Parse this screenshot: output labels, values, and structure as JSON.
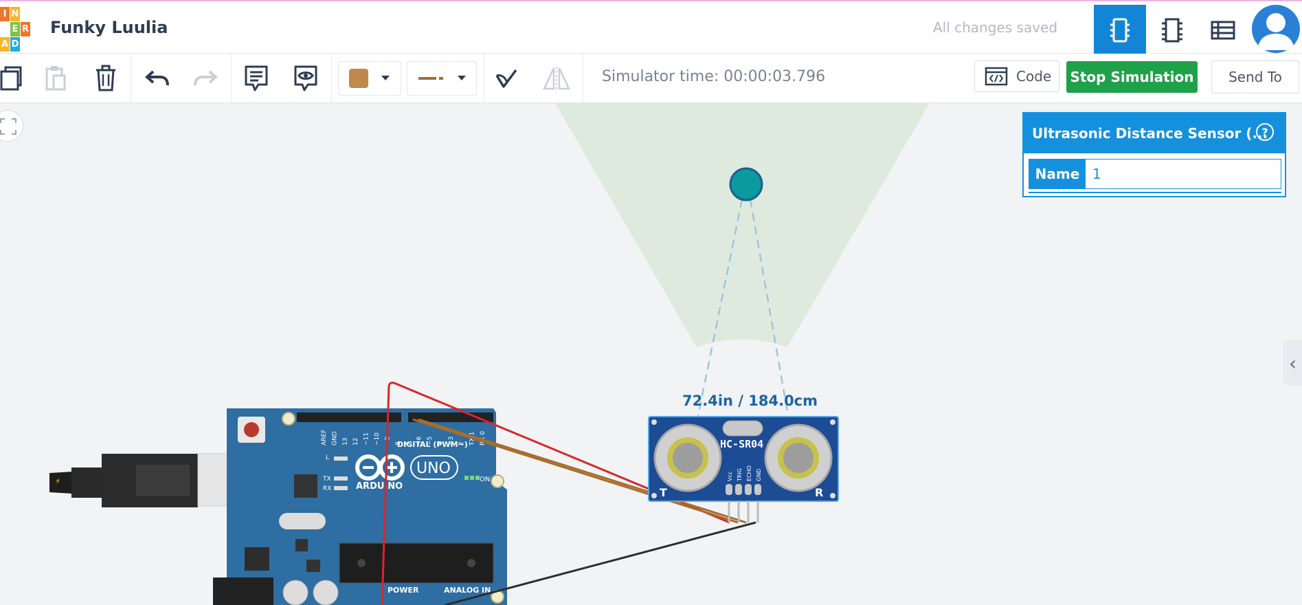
{
  "app": {
    "logo_letters": [
      "I",
      "N",
      "E",
      "R",
      "A",
      "D"
    ],
    "project_name": "Funky Luulia",
    "save_status": "All changes saved",
    "views": [
      "circuit-view-icon",
      "schematic-view-icon",
      "component-list-icon"
    ]
  },
  "toolbar": {
    "simulator_time": "Simulator time: 00:00:03.796",
    "code_label": "Code",
    "stop_label": "Stop Simulation",
    "send_label": "Send To",
    "color_swatch": "#c0894b",
    "wire_color": "#a86c2c"
  },
  "inspector": {
    "title": "Ultrasonic Distance Sensor (...",
    "help_label": "?",
    "name_label": "Name",
    "name_value": "1"
  },
  "sensor": {
    "distance_label": "72.4in / 184.0cm",
    "model": "HC-SR04",
    "pins": [
      "Vcc",
      "TRIG",
      "ECHO",
      "GND"
    ],
    "t_label": "T",
    "r_label": "R"
  },
  "arduino": {
    "brand": "ARDUINO",
    "model": "UNO",
    "digital_label": "DIGITAL (PWM~)",
    "power_label": "POWER",
    "analog_label": "ANALOG IN",
    "on_label": "ON",
    "pin_labels": [
      "AREF",
      "GND",
      "13",
      "12",
      "~11",
      "~10",
      "~9",
      "8",
      "7",
      "~6",
      "~5",
      "4",
      "~3",
      "2",
      "TX 1",
      "RX 0"
    ],
    "led_labels": [
      "L",
      "TX",
      "RX"
    ]
  },
  "colors": {
    "accent": "#1590dd",
    "stop_green": "#1fa14a",
    "board_blue": "#2e6ea2",
    "sensor_blue": "#1c4c93"
  }
}
